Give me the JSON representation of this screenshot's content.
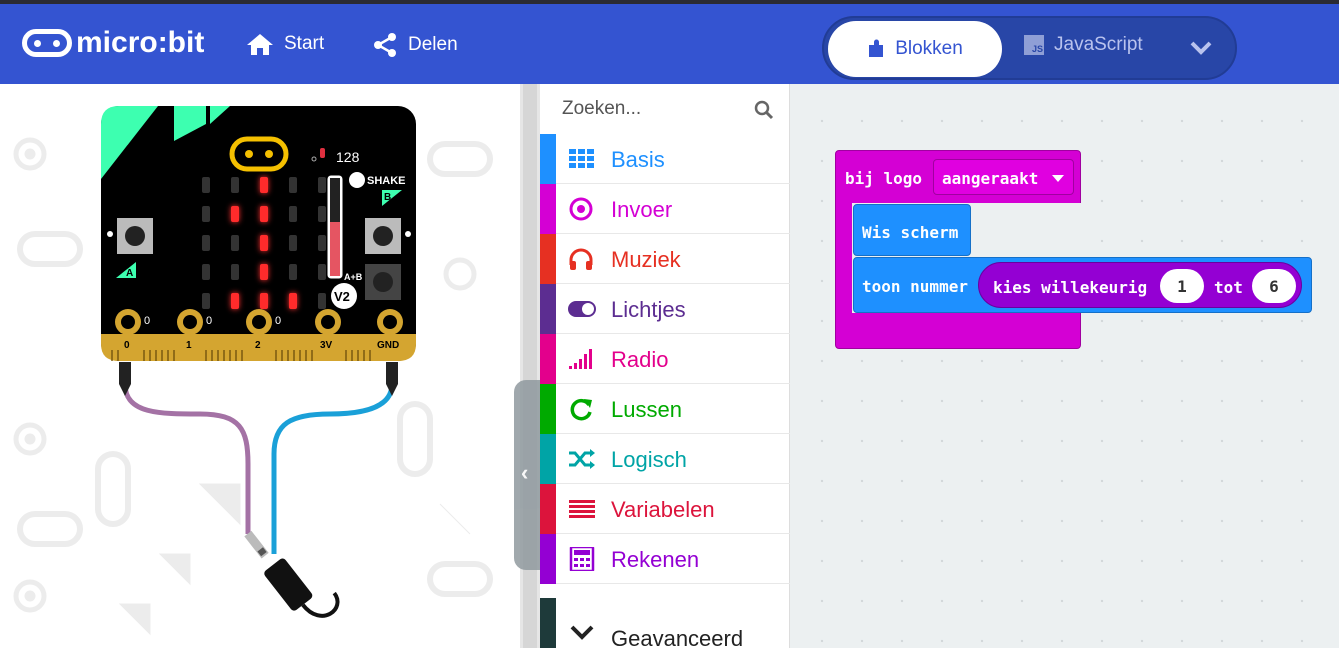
{
  "header": {
    "brand": "micro:bit",
    "nav": [
      {
        "label": "Start",
        "icon": "home-icon"
      },
      {
        "label": "Delen",
        "icon": "share-icon"
      }
    ],
    "editor_toggle": {
      "blocks_label": "Blokken",
      "js_label": "JavaScript",
      "js_badge": "JS"
    }
  },
  "simulator": {
    "sound_level": "128",
    "shake_label": "SHAKE",
    "button_a": "A",
    "button_b": "B",
    "button_ab": "A+B",
    "version": "V2",
    "pins": [
      "0",
      "1",
      "2",
      "3V",
      "GND"
    ],
    "pin_values": [
      "0",
      "0",
      "0"
    ],
    "led_on": [
      [
        0,
        0
      ],
      [
        0,
        1
      ],
      [
        1,
        0
      ],
      [
        1,
        1
      ],
      [
        1,
        2
      ],
      [
        1,
        3
      ],
      [
        2,
        0
      ],
      [
        2,
        1
      ],
      [
        2,
        2
      ],
      [
        3,
        1
      ],
      [
        3,
        2
      ],
      [
        3,
        3
      ],
      [
        4,
        0
      ],
      [
        4,
        1
      ],
      [
        4,
        2
      ]
    ],
    "collapse_icon": "chevron-left-icon"
  },
  "toolbox": {
    "search_placeholder": "Zoeken...",
    "categories": [
      {
        "label": "Basis",
        "color": "#1e90ff",
        "icon": "grid-icon"
      },
      {
        "label": "Invoer",
        "color": "#d400d4",
        "icon": "target-icon"
      },
      {
        "label": "Muziek",
        "color": "#e63022",
        "icon": "headphones-icon"
      },
      {
        "label": "Lichtjes",
        "color": "#5c2d91",
        "icon": "toggle-icon"
      },
      {
        "label": "Radio",
        "color": "#e3008c",
        "icon": "signal-icon"
      },
      {
        "label": "Lussen",
        "color": "#00aa00",
        "icon": "refresh-icon"
      },
      {
        "label": "Logisch",
        "color": "#00a4a6",
        "icon": "shuffle-icon"
      },
      {
        "label": "Variabelen",
        "color": "#dc143c",
        "icon": "list-icon"
      },
      {
        "label": "Rekenen",
        "color": "#9400d3",
        "icon": "calculator-icon"
      }
    ],
    "advanced_label": "Geavanceerd"
  },
  "workspace": {
    "event_block": {
      "prefix": "bij logo",
      "dropdown": "aangeraakt"
    },
    "clear_block": "Wis scherm",
    "show_number_block": {
      "label": "toon nummer",
      "random": "kies willekeurig",
      "from": "1",
      "to_label": "tot",
      "to": "6"
    }
  }
}
